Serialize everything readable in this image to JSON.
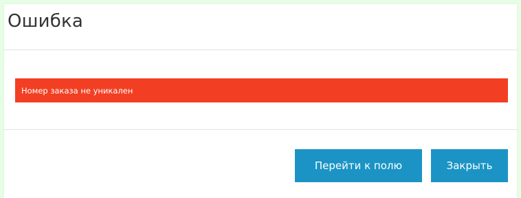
{
  "dialog": {
    "title": "Ошибка",
    "error_message": "Номер заказа не уникален",
    "buttons": {
      "go_to_field": "Перейти к полю",
      "close": "Закрыть"
    }
  },
  "colors": {
    "page_background": "#e6fde6",
    "error_background": "#f23f23",
    "button_background": "#1b94c5"
  }
}
